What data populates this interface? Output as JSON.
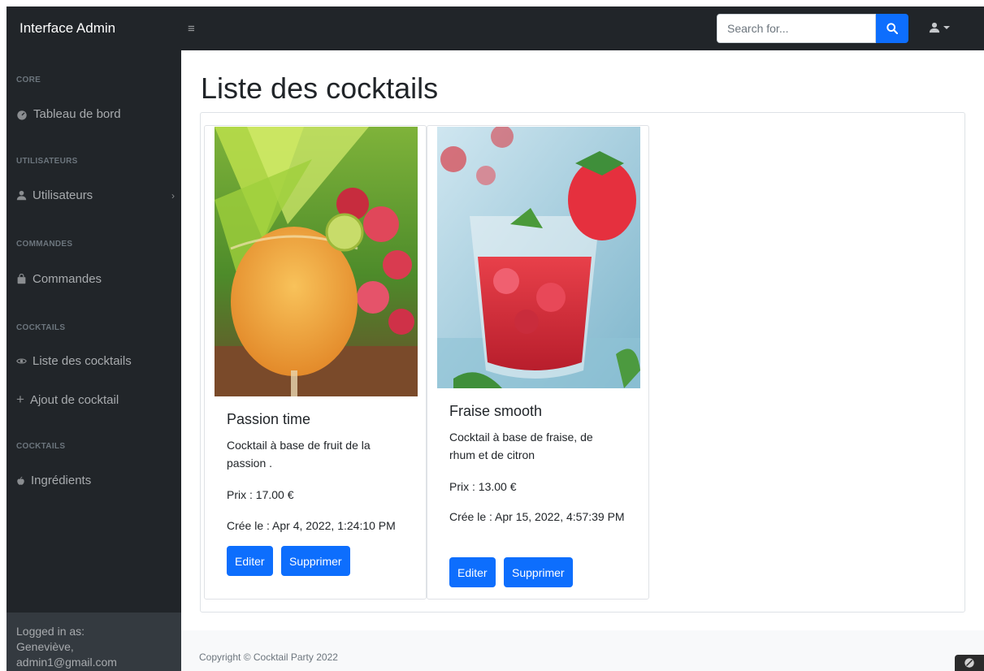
{
  "navbar": {
    "brand": "Interface Admin",
    "toggle_icon": "bars-icon",
    "search_placeholder": "Search for...",
    "search_icon": "search-icon",
    "user_icon": "user-icon"
  },
  "sidebar": {
    "sections": [
      {
        "heading": "CORE",
        "items": [
          {
            "label": "Tableau de bord",
            "icon": "tachometer-icon"
          }
        ]
      },
      {
        "heading": "UTILISATEURS",
        "items": [
          {
            "label": "Utilisateurs",
            "icon": "user-icon",
            "has_caret": true
          }
        ]
      },
      {
        "heading": "COMMANDES",
        "items": [
          {
            "label": "Commandes",
            "icon": "shopping-bag-icon"
          }
        ]
      },
      {
        "heading": "COCKTAILS",
        "items": [
          {
            "label": "Liste des cocktails",
            "icon": "eye-icon"
          },
          {
            "label": "Ajout de cocktail",
            "icon": "plus-icon"
          }
        ]
      },
      {
        "heading": "COCKTAILS",
        "items": [
          {
            "label": "Ingrédients",
            "icon": "apple-icon"
          }
        ]
      }
    ],
    "footer": {
      "label": "Logged in as:",
      "user": "Geneviève,",
      "email": "admin1@gmail.com"
    }
  },
  "main": {
    "title": "Liste des cocktails",
    "cocktails": [
      {
        "name": "Passion time",
        "description": "Cocktail à base de fruit de la passion .",
        "price": "Prix : 17.00 €",
        "created": "Crée le : Apr 4, 2022, 1:24:10 PM",
        "edit_label": "Editer",
        "delete_label": "Supprimer"
      },
      {
        "name": "Fraise smooth",
        "description": "Cocktail à base de fraise, de rhum et de citron",
        "price": "Prix : 13.00 €",
        "created": "Crée le : Apr 15, 2022, 4:57:39 PM",
        "edit_label": "Editer",
        "delete_label": "Supprimer"
      }
    ]
  },
  "footer": {
    "copyright": "Copyright © Cocktail Party 2022"
  },
  "colors": {
    "navbar_bg": "#212529",
    "primary": "#0d6efd",
    "sidebar_text": "#a8abae",
    "sidebar_heading": "#6c757d"
  }
}
